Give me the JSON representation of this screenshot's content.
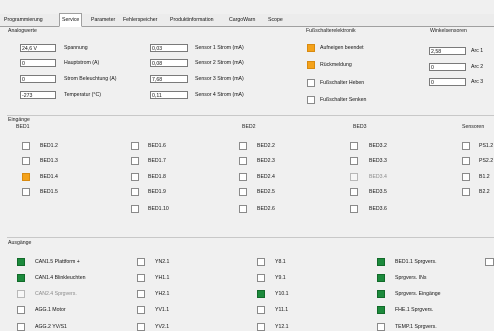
{
  "tabs": [
    "Programmierung",
    "Service",
    "Parameter",
    "Fehlerspeicher",
    "Produktinformation",
    "CargoWarn",
    "Scope"
  ],
  "analog": {
    "title": "Analogwerte",
    "left_rows": [
      {
        "value": "24,6 V",
        "label": "Spannung"
      },
      {
        "value": "0",
        "label": "Hauptstrom (A)"
      },
      {
        "value": "0",
        "label": "Strom Beleuchtung (A)"
      },
      {
        "value": "-273",
        "label": "Temperatur (°C)"
      }
    ],
    "right_rows": [
      {
        "value": "0,03",
        "label": "Sensor 1 Strom (mA)"
      },
      {
        "value": "0,08",
        "label": "Sensor 2 Strom (mA)"
      },
      {
        "value": "7,68",
        "label": "Sensor 3 Strom (mA)"
      },
      {
        "value": "0,11",
        "label": "Sensor 4 Strom (mA)"
      }
    ]
  },
  "foot": {
    "title": "Fußschalterelektronik",
    "items": [
      {
        "label": "Aufneigen beendet",
        "state": "orange"
      },
      {
        "label": "Rückmeldung",
        "state": "orange"
      },
      {
        "label": "Fußschalter Heben",
        "state": "off"
      },
      {
        "label": "Fußschalter Senken",
        "state": "off"
      }
    ]
  },
  "winkel": {
    "title": "Winkelsensoren",
    "rows": [
      {
        "value": "2,58",
        "label": "Arc 1"
      },
      {
        "value": "0",
        "label": "Arc 2"
      },
      {
        "value": "0",
        "label": "Arc 3"
      }
    ]
  },
  "inputs": {
    "title": "Eingänge",
    "groups": [
      {
        "title": "BED1",
        "col1": [
          {
            "label": "BED1.2",
            "state": "off"
          },
          {
            "label": "BED1.3",
            "state": "off"
          },
          {
            "label": "BED1.4",
            "state": "orange"
          },
          {
            "label": "BED1.5",
            "state": "off"
          }
        ],
        "col2": [
          {
            "label": "BED1.6",
            "state": "off"
          },
          {
            "label": "BED1.7",
            "state": "off"
          },
          {
            "label": "BED1.8",
            "state": "off"
          },
          {
            "label": "BED1.9",
            "state": "off"
          },
          {
            "label": "BED1.10",
            "state": "off"
          }
        ]
      },
      {
        "title": "BED2",
        "col1": [
          {
            "label": "BED2.2",
            "state": "off"
          },
          {
            "label": "BED2.3",
            "state": "off"
          },
          {
            "label": "BED2.4",
            "state": "off"
          },
          {
            "label": "BED2.5",
            "state": "off"
          },
          {
            "label": "BED2.6",
            "state": "off"
          }
        ]
      },
      {
        "title": "BED3",
        "col1": [
          {
            "label": "BED3.2",
            "state": "off"
          },
          {
            "label": "BED3.3",
            "state": "off"
          },
          {
            "label": "BED3.4",
            "state": "dim"
          },
          {
            "label": "BED3.5",
            "state": "off"
          },
          {
            "label": "BED3.6",
            "state": "off"
          }
        ]
      },
      {
        "title": "Sensoren",
        "col1": [
          {
            "label": "PS1.2",
            "state": "off"
          },
          {
            "label": "PS2.2",
            "state": "off"
          },
          {
            "label": "B1.2",
            "state": "off"
          },
          {
            "label": "B2.2",
            "state": "off"
          }
        ]
      }
    ]
  },
  "outputs": {
    "title": "Ausgänge",
    "col1": [
      {
        "label": "CAN1.5 Plattform +",
        "state": "green"
      },
      {
        "label": "CAN1.4 Blinkleuchten",
        "state": "green"
      },
      {
        "label": "CAN2.4 Sprgvers.",
        "state": "dim"
      },
      {
        "label": "AGG.1 Motor",
        "state": "off"
      },
      {
        "label": "AGG.2 YV/S1",
        "state": "off"
      }
    ],
    "col2": [
      {
        "label": "YN2.1",
        "state": "off"
      },
      {
        "label": "YH1.1",
        "state": "off"
      },
      {
        "label": "YH2.1",
        "state": "off"
      },
      {
        "label": "YV1.1",
        "state": "off"
      },
      {
        "label": "YV2.1",
        "state": "off"
      }
    ],
    "col3": [
      {
        "label": "Y8.1",
        "state": "off"
      },
      {
        "label": "Y9.1",
        "state": "off"
      },
      {
        "label": "Y10.1",
        "state": "green"
      },
      {
        "label": "Y11.1",
        "state": "off"
      },
      {
        "label": "Y12.1",
        "state": "off"
      }
    ],
    "col4": [
      {
        "label": "BED1.1 Sprgvers.",
        "state": "green"
      },
      {
        "label": "Sprgvers. INs",
        "state": "green"
      },
      {
        "label": "Sprgvers. Eingänge",
        "state": "green"
      },
      {
        "label": "FHE.1 Sprgvers.",
        "state": "green"
      },
      {
        "label": "TEMP.1 Sprgvers.",
        "state": "off"
      }
    ]
  }
}
